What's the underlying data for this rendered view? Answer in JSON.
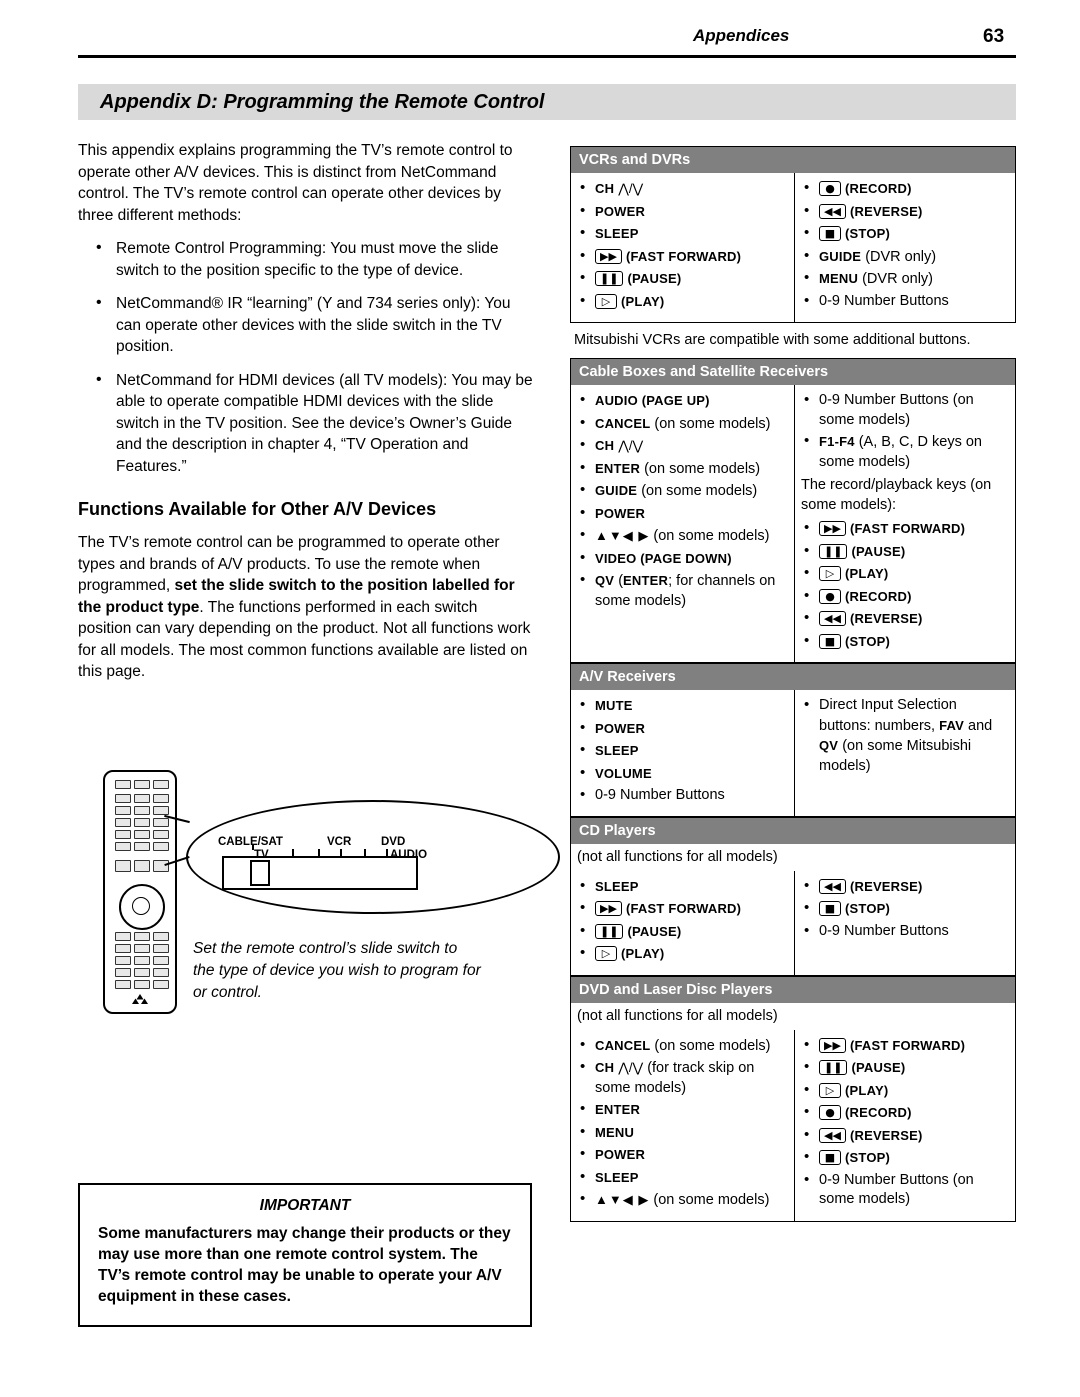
{
  "header": {
    "section": "Appendices",
    "page_number": "63"
  },
  "title": "Appendix D:  Programming the Remote Control",
  "left": {
    "intro": "This appendix explains programming the TV’s remote control to operate other A/V devices.  This is distinct from NetCommand control.  The TV’s remote control can operate other devices by three different methods:",
    "bullets": [
      "Remote Control Programming:  You must move the slide switch to the position specific to the type of device.",
      "NetCommand® IR “learning” (Y and 734 series only):  You can operate other devices with the slide switch in the TV position.",
      "NetCommand for HDMI devices (all TV models):  You may be able to operate compatible HDMI devices with the slide switch in the TV position.  See the device’s Owner’s Guide and the description in chapter 4, “TV Operation and Features.”"
    ],
    "subhead": "Functions Available for Other A/V Devices",
    "body1": "The TV’s remote control can be programmed to operate other types and brands of A/V products.  To use the remote when programmed, ",
    "body1_bold": "set the slide switch to the position labelled for the product type",
    "body1_end": ".  The functions performed in each switch position can vary depending on the product.  Not all functions work for all models.  The most common functions available are listed on this page.",
    "illustration": {
      "labels": [
        "CABLE/SAT",
        "VCR",
        "DVD",
        "TV",
        "AUDIO"
      ],
      "caption": "Set the remote control’s slide switch to the type of device you wish to program for or control."
    },
    "important": {
      "title": "IMPORTANT",
      "text": "Some manufacturers may change their products or they may use more than one remote control system.  The TV’s remote control may be unable to operate your A/V equipment in these cases."
    }
  },
  "right": {
    "sections": [
      {
        "heading": "VCRs and DVRs",
        "left_items": [
          {
            "icon": "",
            "bold": "CH",
            "text": "CH ∧/∨"
          },
          {
            "icon": "",
            "bold": "POWER",
            "text": "POWER"
          },
          {
            "icon": "",
            "bold": "SLEEP",
            "text": "SLEEP"
          },
          {
            "icon": "fast-forward",
            "bold": "",
            "text": "(FAST FORWARD)"
          },
          {
            "icon": "pause",
            "bold": "",
            "text": "(PAUSE)"
          },
          {
            "icon": "play",
            "bold": "",
            "text": "(PLAY)"
          }
        ],
        "right_items": [
          {
            "icon": "record",
            "text": "(RECORD)"
          },
          {
            "icon": "reverse",
            "text": "(REVERSE)"
          },
          {
            "icon": "stop",
            "text": "(STOP)"
          },
          {
            "icon": "",
            "bold": "GUIDE",
            "text": "GUIDE (DVR only)"
          },
          {
            "icon": "",
            "bold": "MENU",
            "text": "MENU (DVR only)"
          },
          {
            "icon": "",
            "text": "0-9 Number Buttons"
          }
        ],
        "note": ""
      },
      {
        "heading": "Cable Boxes and Satellite Receivers",
        "note_above": "Mitsubishi VCRs are compatible with some additional buttons.",
        "left_items": [
          {
            "text": "AUDIO (PAGE UP)"
          },
          {
            "text": "CANCEL (on some models)"
          },
          {
            "text": "CH ∧/∨"
          },
          {
            "text": "ENTER (on some models)"
          },
          {
            "text": "GUIDE (on some models)"
          },
          {
            "text": "POWER"
          },
          {
            "text": "▲▼◀ ▶ (on some models)"
          },
          {
            "text": "VIDEO (PAGE DOWN)"
          },
          {
            "text": "QV (ENTER; for channels on some models)"
          }
        ],
        "right_items": [
          {
            "text": "0-9 Number Buttons (on some models)"
          },
          {
            "text": "F1-F4 (A, B, C, D keys on some models)"
          },
          {
            "text": "The record/playback keys (on some models):"
          },
          {
            "icon": "fast-forward",
            "text": "(FAST FORWARD)"
          },
          {
            "icon": "pause",
            "text": "(PAUSE)"
          },
          {
            "icon": "play",
            "text": "(PLAY)"
          },
          {
            "icon": "record",
            "text": "(RECORD)"
          },
          {
            "icon": "reverse",
            "text": "(REVERSE)"
          },
          {
            "icon": "stop",
            "text": "(STOP)"
          }
        ]
      },
      {
        "heading": "A/V Receivers",
        "left_items": [
          {
            "text": "MUTE"
          },
          {
            "text": "POWER"
          },
          {
            "text": "SLEEP"
          },
          {
            "text": "VOLUME"
          },
          {
            "text": "0-9 Number Buttons"
          }
        ],
        "right_items": [
          {
            "text": "Direct Input Selection buttons:  numbers, FAV and QV (on some Mitsubishi models)"
          }
        ]
      },
      {
        "heading": "CD Players",
        "note": "(not all functions for all models)",
        "left_items": [
          {
            "text": "SLEEP"
          },
          {
            "icon": "fast-forward",
            "text": "(FAST FORWARD)"
          },
          {
            "icon": "pause",
            "text": "(PAUSE)"
          },
          {
            "icon": "play",
            "text": "(PLAY)"
          }
        ],
        "right_items": [
          {
            "icon": "reverse",
            "text": "(REVERSE)"
          },
          {
            "icon": "stop",
            "text": "(STOP)"
          },
          {
            "text": "0-9 Number Buttons"
          }
        ]
      },
      {
        "heading": "DVD and Laser Disc Players",
        "note": "(not all functions for all models)",
        "left_items": [
          {
            "text": "CANCEL (on some models)"
          },
          {
            "text": "CH ∧/∨ (for track skip on some models)"
          },
          {
            "text": "ENTER"
          },
          {
            "text": "MENU"
          },
          {
            "text": "POWER"
          },
          {
            "text": "SLEEP"
          },
          {
            "text": "▲▼◀ ▶ (on some models)"
          }
        ],
        "right_items": [
          {
            "icon": "fast-forward",
            "text": "(FAST FORWARD)"
          },
          {
            "icon": "pause",
            "text": "(PAUSE)"
          },
          {
            "icon": "play",
            "text": "(PLAY)"
          },
          {
            "icon": "record",
            "text": "(RECORD)"
          },
          {
            "icon": "reverse",
            "text": "(REVERSE)"
          },
          {
            "icon": "stop",
            "text": "(STOP)"
          },
          {
            "text": "0-9 Number Buttons (on some models)"
          }
        ]
      }
    ]
  }
}
